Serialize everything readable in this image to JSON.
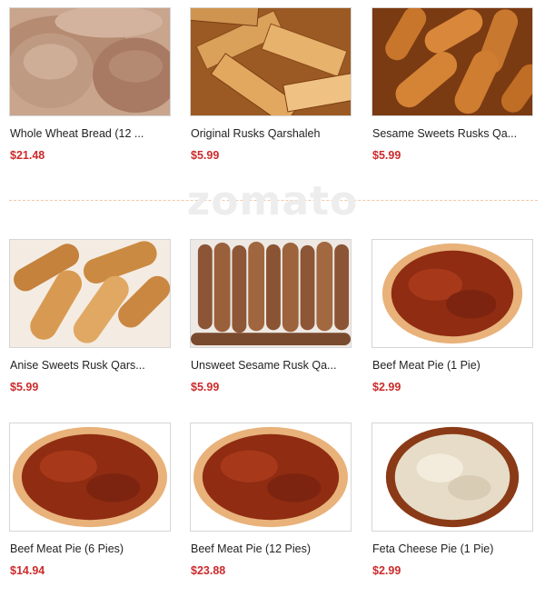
{
  "watermark": "zomato",
  "rows": [
    [
      {
        "name": "Whole Wheat Bread (12 ...",
        "price": "$21.48",
        "image": "pita-bread-image"
      },
      {
        "name": "Original Rusks Qarshaleh",
        "price": "$5.99",
        "image": "rusks-image"
      },
      {
        "name": "Sesame Sweets Rusks Qa...",
        "price": "$5.99",
        "image": "sesame-rusks-image"
      }
    ],
    [
      {
        "name": "Anise Sweets Rusk Qars...",
        "price": "$5.99",
        "image": "anise-rusk-image"
      },
      {
        "name": "Unsweet Sesame Rusk Qa...",
        "price": "$5.99",
        "image": "sesame-sticks-image"
      },
      {
        "name": "Beef Meat Pie (1 Pie)",
        "price": "$2.99",
        "image": "meat-pie-image"
      }
    ],
    [
      {
        "name": "Beef Meat Pie (6 Pies)",
        "price": "$14.94",
        "image": "meat-pie-image"
      },
      {
        "name": "Beef Meat Pie (12 Pies)",
        "price": "$23.88",
        "image": "meat-pie-image"
      },
      {
        "name": "Feta Cheese Pie (1 Pie)",
        "price": "$2.99",
        "image": "cheese-pie-image"
      }
    ]
  ],
  "colors": {
    "price": "#cc2b2b",
    "divider": "#f2c7a3"
  }
}
